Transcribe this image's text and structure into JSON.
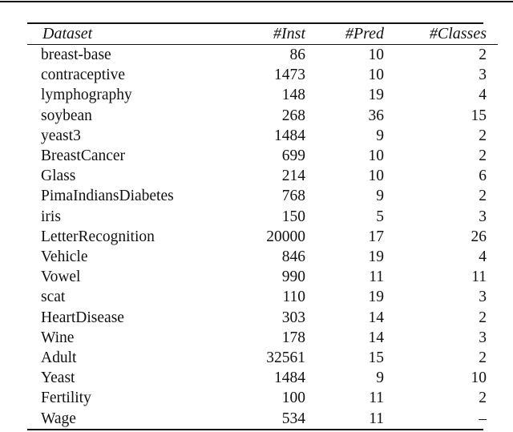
{
  "table": {
    "headers": [
      "Dataset",
      "#Inst",
      "#Pred",
      "#Classes"
    ],
    "rows": [
      [
        "breast-base",
        "86",
        "10",
        "2"
      ],
      [
        "contraceptive",
        "1473",
        "10",
        "3"
      ],
      [
        "lymphography",
        "148",
        "19",
        "4"
      ],
      [
        "soybean",
        "268",
        "36",
        "15"
      ],
      [
        "yeast3",
        "1484",
        "9",
        "2"
      ],
      [
        "BreastCancer",
        "699",
        "10",
        "2"
      ],
      [
        "Glass",
        "214",
        "10",
        "6"
      ],
      [
        "PimaIndiansDiabetes",
        "768",
        "9",
        "2"
      ],
      [
        "iris",
        "150",
        "5",
        "3"
      ],
      [
        "LetterRecognition",
        "20000",
        "17",
        "26"
      ],
      [
        "Vehicle",
        "846",
        "19",
        "4"
      ],
      [
        "Vowel",
        "990",
        "11",
        "11"
      ],
      [
        "scat",
        "110",
        "19",
        "3"
      ],
      [
        "HeartDisease",
        "303",
        "14",
        "2"
      ],
      [
        "Wine",
        "178",
        "14",
        "3"
      ],
      [
        "Adult",
        "32561",
        "15",
        "2"
      ],
      [
        "Yeast",
        "1484",
        "9",
        "10"
      ],
      [
        "Fertility",
        "100",
        "11",
        "2"
      ],
      [
        "Wage",
        "534",
        "11",
        "–"
      ]
    ]
  }
}
